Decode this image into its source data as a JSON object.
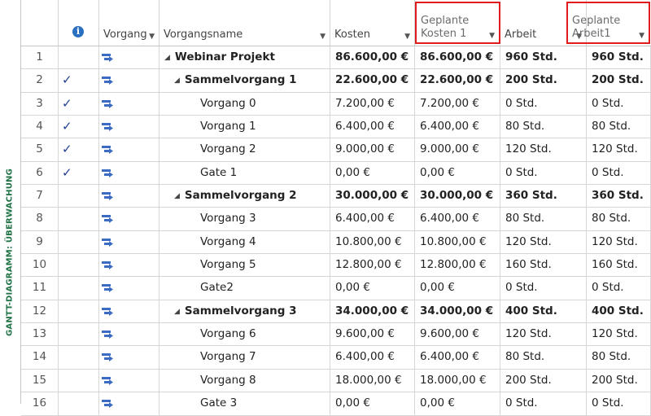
{
  "sidebar": {
    "label": "GANTT-DIAGRAMM: ÜBERWACHUNG"
  },
  "header": {
    "info_icon": "i",
    "col_mode": "Vorgang",
    "col_name": "Vorgangsname",
    "col_costs": "Kosten",
    "col_planned_costs_line1": "Geplante",
    "col_planned_costs_line2": "Kosten 1",
    "col_work": "Arbeit",
    "col_planned_work_line1": "Geplante",
    "col_planned_work_line2": "Arbeit1",
    "dropdown_icon": "▼",
    "red_highlight_color": "#e01b1b"
  },
  "rows": [
    {
      "id": "1",
      "check": "",
      "name": "Webinar Projekt",
      "level": 0,
      "summary": true,
      "collapse": "◢",
      "kosten": "86.600,00 €",
      "geplante_kosten": "86.600,00 €",
      "arbeit": "960 Std.",
      "geplante_arbeit": "960 Std."
    },
    {
      "id": "2",
      "check": "✓",
      "name": "Sammelvorgang 1",
      "level": 1,
      "summary": true,
      "collapse": "◢",
      "kosten": "22.600,00 €",
      "geplante_kosten": "22.600,00 €",
      "arbeit": "200 Std.",
      "geplante_arbeit": "200 Std."
    },
    {
      "id": "3",
      "check": "✓",
      "name": "Vorgang 0",
      "level": 2,
      "summary": false,
      "collapse": "",
      "kosten": "7.200,00 €",
      "geplante_kosten": "7.200,00 €",
      "arbeit": "0 Std.",
      "geplante_arbeit": "0 Std."
    },
    {
      "id": "4",
      "check": "✓",
      "name": "Vorgang 1",
      "level": 2,
      "summary": false,
      "collapse": "",
      "kosten": "6.400,00 €",
      "geplante_kosten": "6.400,00 €",
      "arbeit": "80 Std.",
      "geplante_arbeit": "80 Std."
    },
    {
      "id": "5",
      "check": "✓",
      "name": "Vorgang 2",
      "level": 2,
      "summary": false,
      "collapse": "",
      "kosten": "9.000,00 €",
      "geplante_kosten": "9.000,00 €",
      "arbeit": "120 Std.",
      "geplante_arbeit": "120 Std."
    },
    {
      "id": "6",
      "check": "✓",
      "name": "Gate 1",
      "level": 2,
      "summary": false,
      "collapse": "",
      "kosten": "0,00 €",
      "geplante_kosten": "0,00 €",
      "arbeit": "0 Std.",
      "geplante_arbeit": "0 Std."
    },
    {
      "id": "7",
      "check": "",
      "name": "Sammelvorgang 2",
      "level": 1,
      "summary": true,
      "collapse": "◢",
      "kosten": "30.000,00 €",
      "geplante_kosten": "30.000,00 €",
      "arbeit": "360 Std.",
      "geplante_arbeit": "360 Std."
    },
    {
      "id": "8",
      "check": "",
      "name": "Vorgang 3",
      "level": 2,
      "summary": false,
      "collapse": "",
      "kosten": "6.400,00 €",
      "geplante_kosten": "6.400,00 €",
      "arbeit": "80 Std.",
      "geplante_arbeit": "80 Std."
    },
    {
      "id": "9",
      "check": "",
      "name": "Vorgang 4",
      "level": 2,
      "summary": false,
      "collapse": "",
      "kosten": "10.800,00 €",
      "geplante_kosten": "10.800,00 €",
      "arbeit": "120 Std.",
      "geplante_arbeit": "120 Std."
    },
    {
      "id": "10",
      "check": "",
      "name": "Vorgang 5",
      "level": 2,
      "summary": false,
      "collapse": "",
      "kosten": "12.800,00 €",
      "geplante_kosten": "12.800,00 €",
      "arbeit": "160 Std.",
      "geplante_arbeit": "160 Std."
    },
    {
      "id": "11",
      "check": "",
      "name": "Gate2",
      "level": 2,
      "summary": false,
      "collapse": "",
      "kosten": "0,00 €",
      "geplante_kosten": "0,00 €",
      "arbeit": "0 Std.",
      "geplante_arbeit": "0 Std."
    },
    {
      "id": "12",
      "check": "",
      "name": "Sammelvorgang 3",
      "level": 1,
      "summary": true,
      "collapse": "◢",
      "kosten": "34.000,00 €",
      "geplante_kosten": "34.000,00 €",
      "arbeit": "400 Std.",
      "geplante_arbeit": "400 Std."
    },
    {
      "id": "13",
      "check": "",
      "name": "Vorgang 6",
      "level": 2,
      "summary": false,
      "collapse": "",
      "kosten": "9.600,00 €",
      "geplante_kosten": "9.600,00 €",
      "arbeit": "120 Std.",
      "geplante_arbeit": "120 Std."
    },
    {
      "id": "14",
      "check": "",
      "name": "Vorgang 7",
      "level": 2,
      "summary": false,
      "collapse": "",
      "kosten": "6.400,00 €",
      "geplante_kosten": "6.400,00 €",
      "arbeit": "80 Std.",
      "geplante_arbeit": "80 Std."
    },
    {
      "id": "15",
      "check": "",
      "name": "Vorgang 8",
      "level": 2,
      "summary": false,
      "collapse": "",
      "kosten": "18.000,00 €",
      "geplante_kosten": "18.000,00 €",
      "arbeit": "200 Std.",
      "geplante_arbeit": "200 Std."
    },
    {
      "id": "16",
      "check": "",
      "name": "Gate 3",
      "level": 2,
      "summary": false,
      "collapse": "",
      "kosten": "0,00 €",
      "geplante_kosten": "0,00 €",
      "arbeit": "0 Std.",
      "geplante_arbeit": "0 Std."
    }
  ]
}
